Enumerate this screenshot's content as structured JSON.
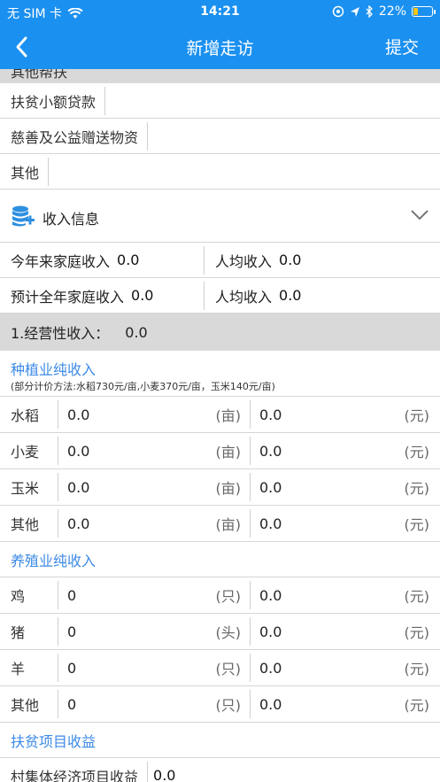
{
  "status": {
    "carrier": "无 SIM 卡",
    "time": "14:21",
    "battery": "22%",
    "battery_level": 0.22
  },
  "nav": {
    "title": "新增走访",
    "submit": "提交"
  },
  "top_band_text": "其他帮扶",
  "other_items": [
    {
      "label": "扶贫小额贷款",
      "value": ""
    },
    {
      "label": "慈善及公益赠送物资",
      "value": ""
    },
    {
      "label": "其他",
      "value": ""
    }
  ],
  "income_section": {
    "title": "收入信息"
  },
  "income_rows": [
    {
      "left_label": "今年来家庭收入",
      "left_value": "0.0",
      "right_label": "人均收入",
      "right_value": "0.0"
    },
    {
      "left_label": "预计全年家庭收入",
      "left_value": "0.0",
      "right_label": "人均收入",
      "right_value": "0.0"
    }
  ],
  "operating": {
    "label": "1.经营性收入：",
    "value": "0.0"
  },
  "planting": {
    "title": "种植业纯收入",
    "note": "(部分计价方法:水稻730元/亩,小麦370元/亩，玉米140元/亩)",
    "rows": [
      {
        "name": "水稻",
        "qty": "0.0",
        "qty_unit": "(亩)",
        "amount": "0.0",
        "amount_unit": "(元)"
      },
      {
        "name": "小麦",
        "qty": "0.0",
        "qty_unit": "(亩)",
        "amount": "0.0",
        "amount_unit": "(元)"
      },
      {
        "name": "玉米",
        "qty": "0.0",
        "qty_unit": "(亩)",
        "amount": "0.0",
        "amount_unit": "(元)"
      },
      {
        "name": "其他",
        "qty": "0.0",
        "qty_unit": "(亩)",
        "amount": "0.0",
        "amount_unit": "(元)"
      }
    ]
  },
  "breeding": {
    "title": "养殖业纯收入",
    "rows": [
      {
        "name": "鸡",
        "qty": "0",
        "qty_unit": "(只)",
        "amount": "0.0",
        "amount_unit": "(元)"
      },
      {
        "name": "猪",
        "qty": "0",
        "qty_unit": "(头)",
        "amount": "0.0",
        "amount_unit": "(元)"
      },
      {
        "name": "羊",
        "qty": "0",
        "qty_unit": "(只)",
        "amount": "0.0",
        "amount_unit": "(元)"
      },
      {
        "name": "其他",
        "qty": "0",
        "qty_unit": "(只)",
        "amount": "0.0",
        "amount_unit": "(元)"
      }
    ]
  },
  "project": {
    "title": "扶贫项目收益",
    "rows": [
      {
        "label": "村集体经济项目收益",
        "value": "0.0"
      }
    ]
  },
  "colors": {
    "nav_bg": "#1a90f0",
    "link_blue": "#3d8ae6",
    "section_gray": "#d9d9d9"
  },
  "icons": [
    "back-arrow-icon",
    "wifi-icon",
    "location-icon",
    "bluetooth-icon",
    "battery-icon",
    "database-add-icon",
    "chevron-down-icon"
  ]
}
